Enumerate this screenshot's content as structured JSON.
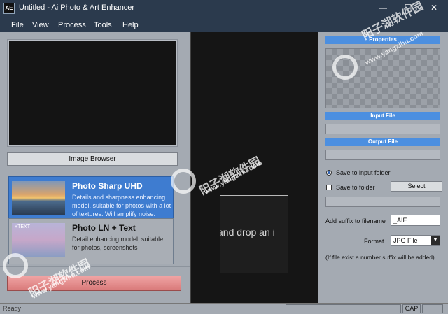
{
  "titlebar": {
    "app_icon": "AE",
    "title": "Untitled - Ai Photo & Art Enhancer",
    "minimize": "—",
    "maximize": "☐",
    "close": "✕"
  },
  "menu": [
    "File",
    "View",
    "Process",
    "Tools",
    "Help"
  ],
  "left": {
    "image_browser_label": "Image Browser",
    "models": [
      {
        "name": "Photo Sharp UHD",
        "description": "Details and sharpness enhancing model, suitable for photos with a lot of textures. Will amplify noise.",
        "selected": true
      },
      {
        "name": "Photo LN + Text",
        "thumb_label": "+TEXT",
        "description": "Detail enhancing model, suitable for photos, screenshots",
        "selected": false
      }
    ],
    "process_label": "Process"
  },
  "center": {
    "drop_text": "and drop an i"
  },
  "right": {
    "properties_header": "Properties",
    "input_file_header": "Input File",
    "output_file_header": "Output File",
    "save_to_input_label": "Save to input folder",
    "save_to_input_checked": true,
    "save_to_folder_label": "Save to folder",
    "save_to_folder_checked": false,
    "select_label": "Select",
    "suffix_label": "Add suffix to filename",
    "suffix_value": "_AIE",
    "format_label": "Format",
    "format_value": "JPG File",
    "note": "(If file exist a number suffix will be added)"
  },
  "status": {
    "text": "Ready",
    "cap": "CAP"
  },
  "watermark": {
    "cn": "阳子湖软件园",
    "url": "www.yangzihu.com"
  },
  "colors": {
    "chrome": "#2b3a4d",
    "panel": "#a4aab2",
    "accent": "#4c8fe0",
    "selected_card": "#3e7cd0",
    "process_button": "#e08d8d"
  }
}
